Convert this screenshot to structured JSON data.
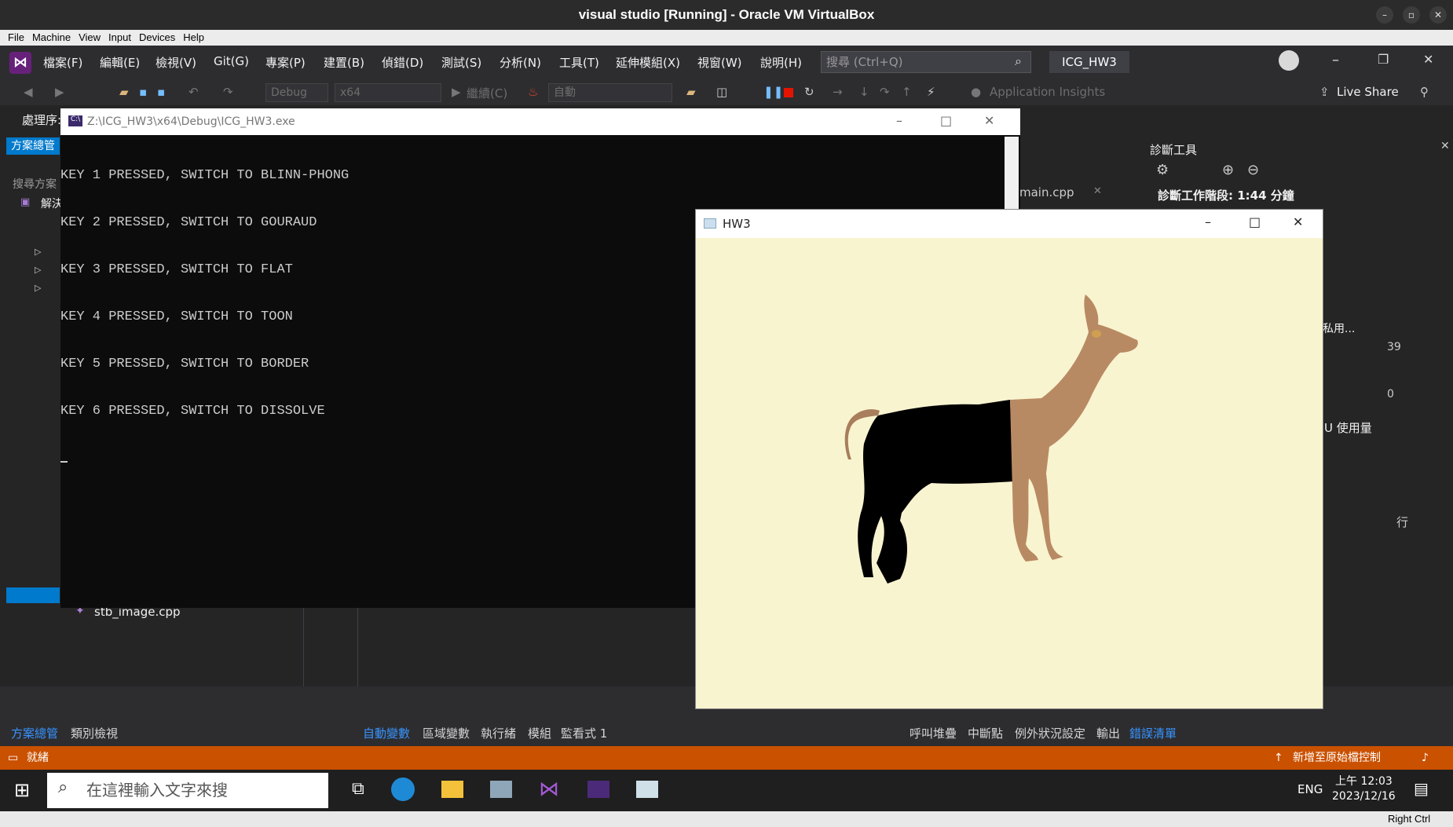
{
  "vbox": {
    "title": "visual studio [Running] - Oracle VM VirtualBox",
    "menu": [
      "File",
      "Machine",
      "View",
      "Input",
      "Devices",
      "Help"
    ],
    "host_key": "Right Ctrl"
  },
  "vs": {
    "menu": [
      "檔案(F)",
      "編輯(E)",
      "檢視(V)",
      "Git(G)",
      "專案(P)",
      "建置(B)",
      "偵錯(D)",
      "測試(S)",
      "分析(N)",
      "工具(T)",
      "延伸模組(X)",
      "視窗(W)",
      "說明(H)"
    ],
    "search_placeholder": "搜尋 (Ctrl+Q)",
    "solution_name": "ICG_HW3",
    "toolbar": {
      "config": "Debug",
      "platform": "x64",
      "continue": "繼續(C)",
      "auto": "自動",
      "app_insights": "Application Insights",
      "live_share": "Live Share"
    },
    "process_label": "處理序:",
    "solution_tab": "方案總管",
    "solution_search": "搜尋方案",
    "solution_root": "解決",
    "file_item": "stb_image.cpp",
    "editor_tab": "main.cpp",
    "diag": {
      "title": "診斷工具",
      "session": "診斷工作階段: 1:44 分鐘",
      "private": "私用...",
      "val_top": "39",
      "val_bottom": "0",
      "cpu": "U 使用量"
    },
    "bottom_tabs_left": [
      "方案總管",
      "類別檢視"
    ],
    "bottom_tabs_mid": [
      "自動變數",
      "區域變數",
      "執行緒",
      "模組",
      "監看式 1"
    ],
    "bottom_tabs_right": [
      "呼叫堆疊",
      "中斷點",
      "例外狀況設定",
      "輸出",
      "錯誤清單"
    ],
    "col_row": "行",
    "status_ready": "就緒",
    "status_source": "新增至原始檔控制"
  },
  "console": {
    "title": "Z:\\ICG_HW3\\x64\\Debug\\ICG_HW3.exe",
    "lines": [
      "KEY 1 PRESSED, SWITCH TO BLINN-PHONG",
      "KEY 2 PRESSED, SWITCH TO GOURAUD",
      "KEY 3 PRESSED, SWITCH TO FLAT",
      "KEY 4 PRESSED, SWITCH TO TOON",
      "KEY 5 PRESSED, SWITCH TO BORDER",
      "KEY 6 PRESSED, SWITCH TO DISSOLVE"
    ]
  },
  "hw3": {
    "title": "HW3",
    "bg": "#f9f4d0"
  },
  "taskbar": {
    "search": "在這裡輸入文字來搜",
    "lang": "ENG",
    "time": "上午 12:03",
    "date": "2023/12/16"
  }
}
